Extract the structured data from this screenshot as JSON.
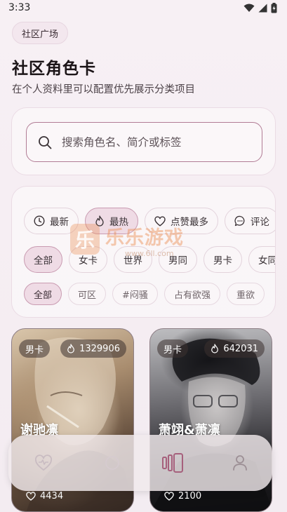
{
  "status": {
    "time": "3:33"
  },
  "header": {
    "chip": "社区广场",
    "title": "社区角色卡",
    "subtitle": "在个人资料里可以配置优先展示分类项目"
  },
  "search": {
    "placeholder": "搜索角色名、简介或标签"
  },
  "sort_options": [
    {
      "label": "最新",
      "icon": "clock-icon"
    },
    {
      "label": "最热",
      "icon": "flame-icon",
      "active": true
    },
    {
      "label": "点赞最多",
      "icon": "heart-icon"
    },
    {
      "label": "评论",
      "icon": "comment-icon"
    }
  ],
  "categories": [
    "全部",
    "女卡",
    "世界",
    "男同",
    "男卡",
    "女同"
  ],
  "tags": [
    "全部",
    "可区",
    "#闷骚",
    "占有欲强",
    "重欲"
  ],
  "watermark": {
    "title": "乐乐游戏",
    "url": "www.6ll.com",
    "glyph": "乐"
  },
  "cards": [
    {
      "gender": "男卡",
      "hot": "1329906",
      "name": "谢驰凛",
      "likes": "4434"
    },
    {
      "gender": "男卡",
      "hot": "642031",
      "name": "萧翊&萧凛",
      "likes": "2100"
    }
  ],
  "nav": [
    "heart-icon",
    "cards-icon",
    "profile-icon"
  ],
  "colors": {
    "accent": "#b17c95",
    "active_pill": "#efdbe5",
    "background": "#f7f0f4"
  }
}
